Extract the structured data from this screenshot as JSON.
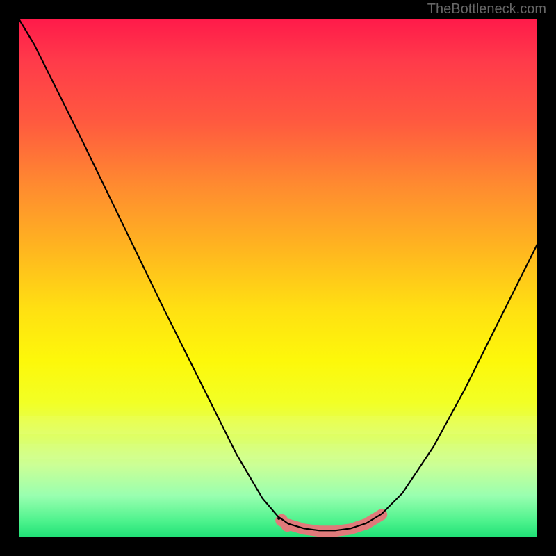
{
  "watermark": "TheBottleneck.com",
  "chart_data": {
    "type": "line",
    "title": "",
    "xlabel": "",
    "ylabel": "",
    "x_range": [
      0,
      100
    ],
    "y_range": [
      0,
      100
    ],
    "curve": [
      {
        "x": 0.0,
        "y": 100.0
      },
      {
        "x": 3.0,
        "y": 95.0
      },
      {
        "x": 6.0,
        "y": 89.0
      },
      {
        "x": 12.0,
        "y": 77.0
      },
      {
        "x": 20.0,
        "y": 60.5
      },
      {
        "x": 28.0,
        "y": 44.0
      },
      {
        "x": 36.0,
        "y": 28.0
      },
      {
        "x": 42.0,
        "y": 16.0
      },
      {
        "x": 47.0,
        "y": 7.5
      },
      {
        "x": 50.0,
        "y": 4.0
      },
      {
        "x": 52.0,
        "y": 2.6
      },
      {
        "x": 55.0,
        "y": 1.7
      },
      {
        "x": 58.0,
        "y": 1.3
      },
      {
        "x": 61.0,
        "y": 1.3
      },
      {
        "x": 64.0,
        "y": 1.7
      },
      {
        "x": 67.0,
        "y": 2.7
      },
      {
        "x": 70.0,
        "y": 4.5
      },
      {
        "x": 74.0,
        "y": 8.5
      },
      {
        "x": 80.0,
        "y": 17.5
      },
      {
        "x": 86.0,
        "y": 28.5
      },
      {
        "x": 92.0,
        "y": 40.5
      },
      {
        "x": 97.0,
        "y": 50.5
      },
      {
        "x": 100.0,
        "y": 56.5
      }
    ],
    "optimal_band_x": [
      52,
      70
    ],
    "markers": [
      {
        "x": 50.7,
        "y": 3.4
      },
      {
        "x": 51.8,
        "y": 2.4
      }
    ],
    "colors": {
      "high": "#ff1a4a",
      "mid": "#ffe012",
      "low": "#1fe076",
      "marker": "#e07a7a",
      "curve": "#000000",
      "background": "#000000"
    }
  }
}
